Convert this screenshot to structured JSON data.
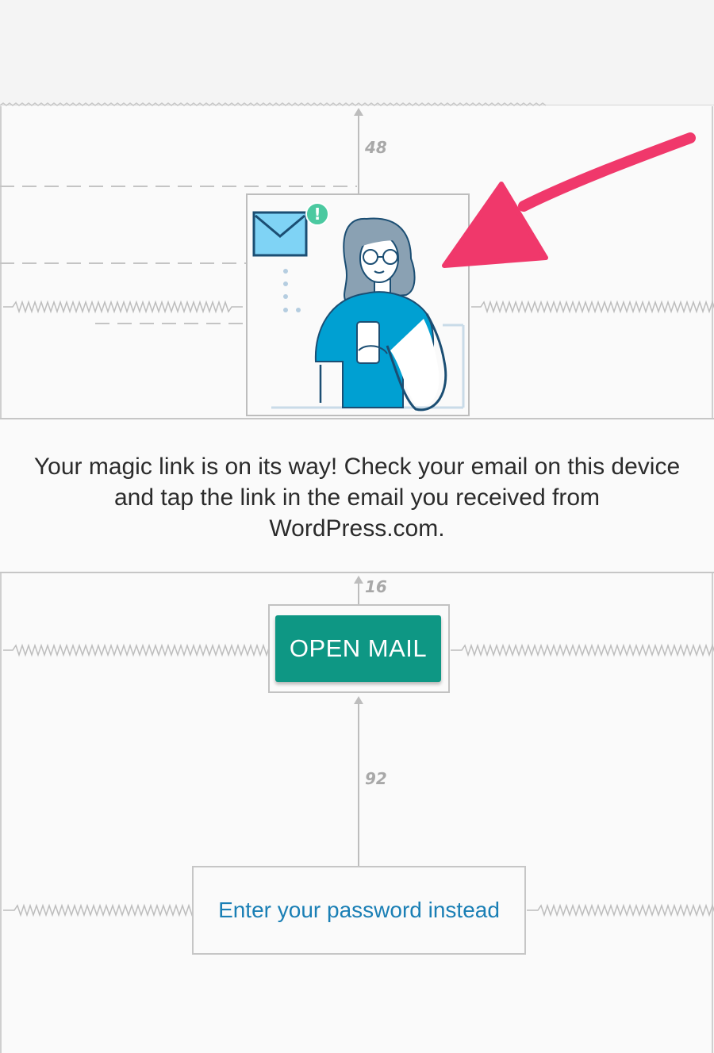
{
  "spacing_labels": {
    "top_gap": "48",
    "button_gap": "16",
    "bottom_gap": "92"
  },
  "message": {
    "text": "Your magic link is on its way! Check your email on this device and tap the link in the email you received from WordPress.com."
  },
  "actions": {
    "open_mail_label": "OPEN MAIL",
    "password_link_label": "Enter your password instead"
  },
  "illustration": {
    "badge_text": "!"
  },
  "colors": {
    "accent_button": "#0e9784",
    "link": "#1a7fb5",
    "arrow": "#f0386b",
    "shirt": "#00a0d2",
    "hair": "#8aa1b3",
    "envelope": "#7fd3f5",
    "badge": "#4bc9a0"
  },
  "icons": {
    "arrow": "pointer-arrow-icon",
    "envelope": "envelope-icon",
    "badge": "alert-badge-icon"
  }
}
